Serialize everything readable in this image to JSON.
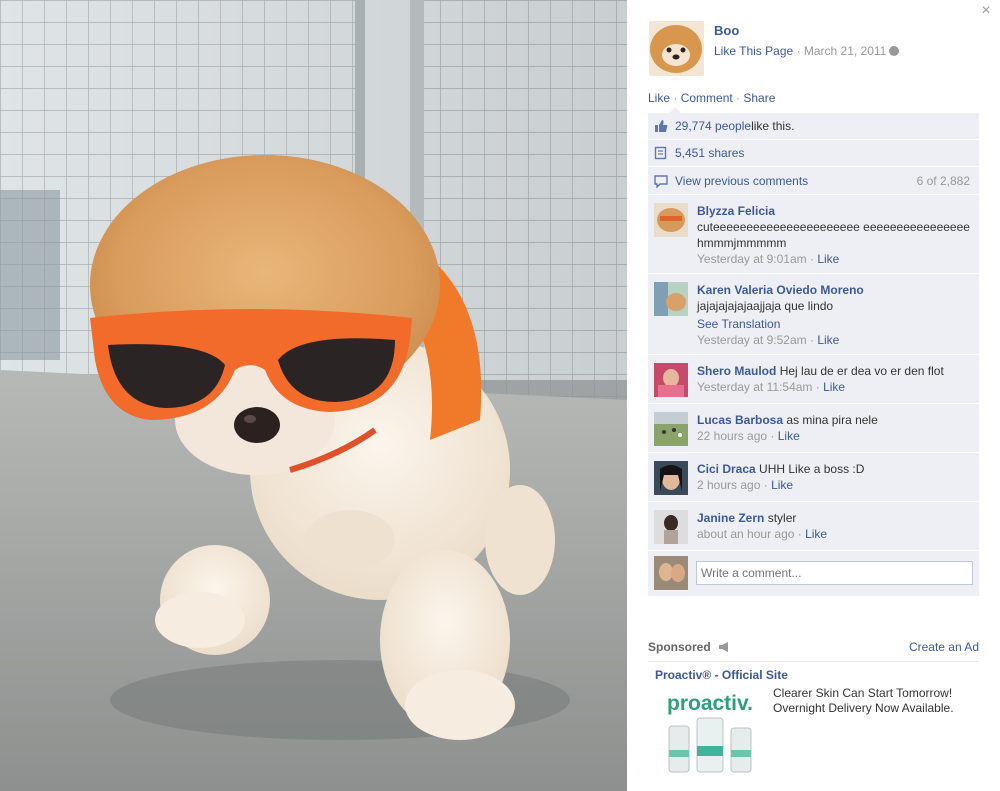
{
  "window": {
    "close_glyph": "×"
  },
  "owner": {
    "name": "Boo",
    "like_page": "Like This Page",
    "separator": " · ",
    "date": "March 21, 2011"
  },
  "actions": {
    "like": "Like",
    "comment": "Comment",
    "share": "Share",
    "dot": " · "
  },
  "ufi": {
    "likes_count": "29,774 people",
    "likes_suffix": " like this.",
    "shares": "5,451 shares",
    "view_previous": "View previous comments",
    "comment_count": "6 of 2,882"
  },
  "comments": [
    {
      "author": "Blyzza Felicia",
      "text": "cuteeeeeeeeeeeeeeeeeeeeee eeeeeeeeeeeeeeee hmmmjmmmmm",
      "time": "Yesterday at 9:01am",
      "like": "Like",
      "translation": ""
    },
    {
      "author": "Karen Valeria Oviedo Moreno",
      "text": "jajajajajajaajjaja que lindo",
      "time": "Yesterday at 9:52am",
      "like": "Like",
      "translation": "See Translation"
    },
    {
      "author": "Shero Maulod",
      "text": "Hej lau de er dea vo er den flot",
      "time": "Yesterday at 11:54am",
      "like": "Like",
      "translation": ""
    },
    {
      "author": "Lucas Barbosa",
      "text": "as mina pira nele",
      "time": "22 hours ago",
      "like": "Like",
      "translation": ""
    },
    {
      "author": "Cici Draca",
      "text": "UHH Like a boss :D",
      "time": "2 hours ago",
      "like": "Like",
      "translation": ""
    },
    {
      "author": "Janine Zern",
      "text": "styler",
      "time": "about an hour ago",
      "like": "Like",
      "translation": ""
    }
  ],
  "write_comment": {
    "placeholder": "Write a comment..."
  },
  "sponsored": {
    "label": "Sponsored",
    "create_ad": "Create an Ad"
  },
  "ad": {
    "title": "Proactiv® - Official Site",
    "logo": "proactiv.",
    "line1": "Clearer Skin Can Start Tomorrow!",
    "line2": "Overnight Delivery Now Available."
  },
  "colors": {
    "link": "#3b5998",
    "ufi_bg": "#edeff4",
    "muted": "#999999"
  },
  "icons": [
    "close-icon",
    "globe-icon",
    "thumbs-up-icon",
    "share-icon",
    "comment-bubble-icon",
    "megaphone-icon"
  ]
}
